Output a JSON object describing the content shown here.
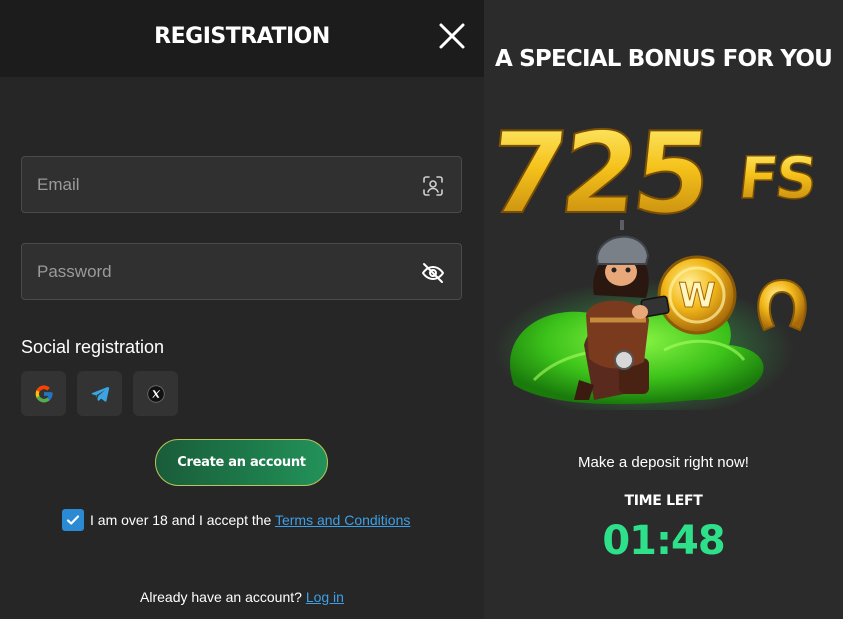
{
  "registration": {
    "title": "REGISTRATION",
    "close_icon": "close-icon",
    "email": {
      "placeholder": "Email",
      "value": "",
      "icon": "user-scan-icon"
    },
    "password": {
      "placeholder": "Password",
      "value": "",
      "icon": "eye-off-icon"
    },
    "social_title": "Social registration",
    "social_buttons": [
      {
        "name": "google",
        "icon": "google-icon"
      },
      {
        "name": "telegram",
        "icon": "telegram-icon"
      },
      {
        "name": "x",
        "icon": "x-icon"
      }
    ],
    "create_button": "Create an account",
    "agree_text": "I am over 18 and I accept the ",
    "terms_link": "Terms and Conditions",
    "agree_checked": true,
    "already_text": "Already have an account? ",
    "login_link": "Log in"
  },
  "bonus": {
    "title": "A SPECIAL BONUS FOR YOU",
    "amount": "725",
    "unit": "FS",
    "deposit_text": "Make a deposit right now!",
    "time_left_label": "TIME LEFT",
    "timer": "01:48"
  },
  "colors": {
    "accent_green": "#2ee08a",
    "link_blue": "#3da0e6",
    "checkbox_blue": "#2a8ad4",
    "button_green": "#1d7a4a",
    "gold": "#f5c21b"
  }
}
